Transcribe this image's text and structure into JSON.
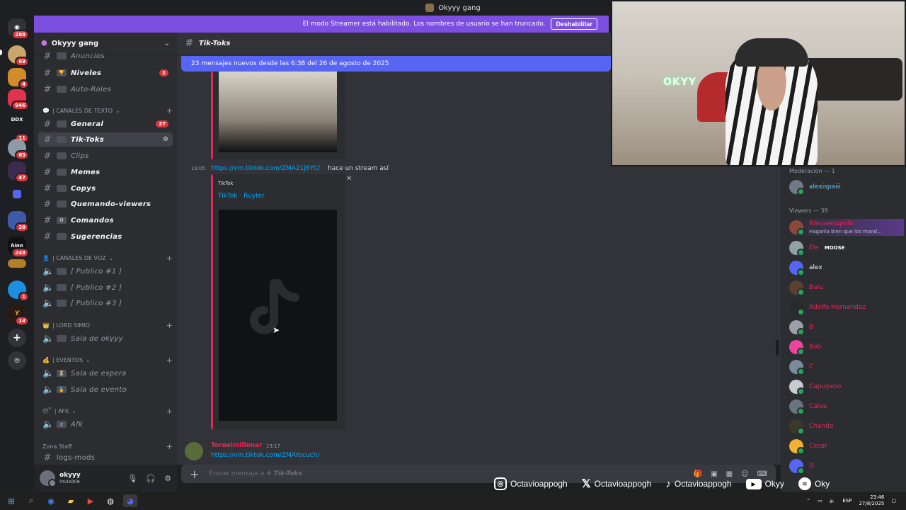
{
  "window": {
    "title": "Okyyy gang"
  },
  "streamer_banner": {
    "text": "El modo Streamer está habilitado. Los nombres de usuario se han truncado.",
    "button": "Deshabilitar"
  },
  "rail": {
    "badges": [
      "288",
      "69",
      "4",
      "946",
      "DDX",
      "11",
      "65",
      "47",
      "28",
      "248",
      "1",
      "14"
    ]
  },
  "guild": {
    "name": "Okyyy gang"
  },
  "channels": {
    "top": [
      {
        "name": "Anuncios"
      },
      {
        "name": "Niveles",
        "count": "2"
      },
      {
        "name": "Auto-Roles"
      }
    ],
    "cat_texto": "| CANALES DE TEXTO",
    "texto": [
      {
        "name": "General",
        "count": "27"
      },
      {
        "name": "Tik-Toks"
      },
      {
        "name": "Clips"
      },
      {
        "name": "Memes"
      },
      {
        "name": "Copys"
      },
      {
        "name": "Quemando-viewers"
      },
      {
        "name": "Comandos"
      },
      {
        "name": "Sugerencias"
      }
    ],
    "cat_voz": "| CANALES DE VOZ",
    "voz": [
      {
        "name": "[ Publico #1 ]"
      },
      {
        "name": "[ Publico #2 ]"
      },
      {
        "name": "[ Publico #3 ]"
      }
    ],
    "cat_lord": "| LORD SIMIO",
    "lord": [
      {
        "name": "Sala de okyyy"
      }
    ],
    "cat_eventos": "| EVENTOS",
    "eventos": [
      {
        "name": "Sala de espera"
      },
      {
        "name": "Sala de evento"
      }
    ],
    "cat_afk": "| AFK",
    "afk": [
      {
        "name": "Afk"
      }
    ],
    "cat_staff": "Zona Staff",
    "staff": [
      {
        "name": "logs-mods"
      }
    ]
  },
  "user": {
    "name": "okyyy",
    "status": "Invisible"
  },
  "chat": {
    "channel": "Tik-Toks",
    "new_messages": "23 mensajes nuevos desde las 6:38 del 26 de agosto de 2025",
    "msg1": {
      "time": "19:05",
      "link": "https://vm.tiktok.com/ZMA21J6YC/",
      "text": "hace un stream así"
    },
    "embed": {
      "provider": "TikTok",
      "title": "TikTok · Ruyter"
    },
    "msg2": {
      "author": "Toroelmillonar",
      "time": "19:17",
      "link": "https://vm.tiktok.com/ZMAYocuch/"
    },
    "composer_placeholder": "Enviar mensaje a #",
    "composer_channel": "Tik-Toks"
  },
  "members": {
    "group1": "Moderacion — 1",
    "mods": [
      {
        "name": "alexispaiii"
      }
    ],
    "group2": "Viewers — 39",
    "viewers": [
      {
        "name": "Riscoestupido",
        "sub": "Haganla bien que los mand…"
      },
      {
        "name": "Ele",
        "tag": "MOOSE"
      },
      {
        "name": "alex"
      },
      {
        "name": "Balu"
      },
      {
        "name": "Adolfo Hernandez"
      },
      {
        "name": "B"
      },
      {
        "name": "Bob"
      },
      {
        "name": "C"
      },
      {
        "name": "Capuyano"
      },
      {
        "name": "Calva"
      },
      {
        "name": "Chando"
      },
      {
        "name": "Cesar"
      },
      {
        "name": "D"
      }
    ]
  },
  "webcam": {
    "neon_text": "OKYY"
  },
  "socials": [
    {
      "icon": "instagram-icon",
      "handle": "Octavioappogh"
    },
    {
      "icon": "x-icon",
      "handle": "Octavioappogh"
    },
    {
      "icon": "tiktok-icon",
      "handle": "Octavioappogh"
    },
    {
      "icon": "youtube-icon",
      "handle": "Okyy"
    },
    {
      "icon": "spotify-icon",
      "handle": "Oky"
    }
  ],
  "taskbar": {
    "lang": "ESP",
    "time": "23:46",
    "date": "27/8/2025"
  },
  "colors": {
    "accent": "#5865f2",
    "banner": "#7c4fe0",
    "embed_bar": "#e22a57",
    "link": "#00a8fc"
  }
}
